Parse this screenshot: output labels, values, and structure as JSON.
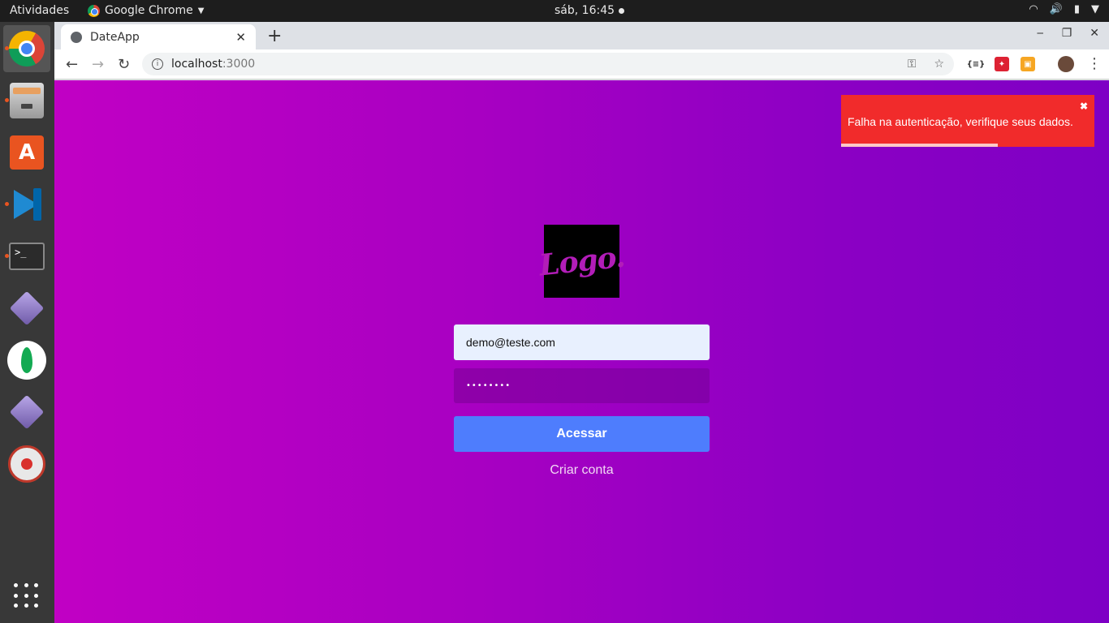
{
  "topbar": {
    "activities": "Atividades",
    "app_name": "Google Chrome",
    "clock": "sáb, 16:45"
  },
  "dock": {
    "icons": [
      "chrome-icon",
      "files-icon",
      "software-store-icon",
      "vscode-icon",
      "terminal-icon",
      "diamond-app-icon",
      "mongodb-compass-icon",
      "diamond-app-icon",
      "atom-app-icon",
      "show-apps-icon"
    ]
  },
  "browser": {
    "tab_title": "DateApp",
    "url_host": "localhost",
    "url_port": ":3000"
  },
  "page": {
    "logo_text": "Logo.",
    "email_value": "demo@teste.com",
    "password_mask": "••••••••",
    "login_button": "Acessar",
    "signup_link": "Criar conta"
  },
  "toast": {
    "message": "Falha na autenticação, verifique seus dados.",
    "close_glyph": "✖",
    "progress": 0.62
  },
  "colors": {
    "toast_bg": "#f12b2b",
    "button_bg": "#4e7dfd",
    "gradient_start": "#c100c4",
    "gradient_end": "#7e00c5"
  }
}
